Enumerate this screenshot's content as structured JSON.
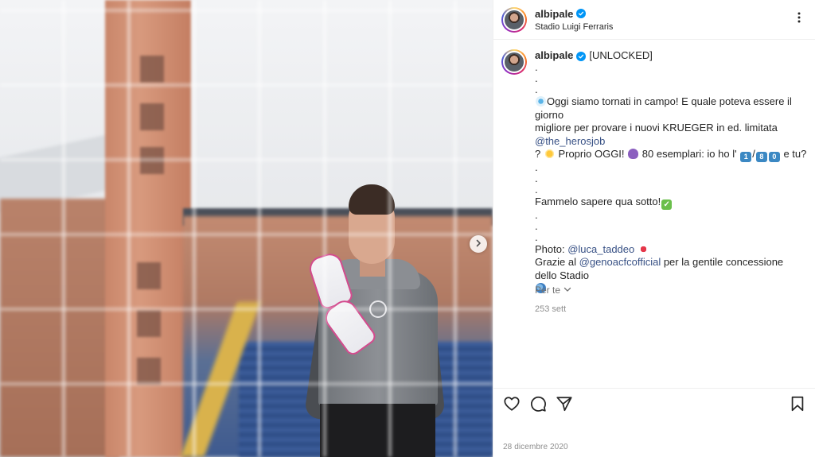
{
  "post": {
    "username": "albipale",
    "location": "Stadio Luigi Ferraris",
    "caption": {
      "tag": "[UNLOCKED]",
      "line1": "Oggi siamo tornati in campo! E quale poteva essere il giorno",
      "line2_pre": "migliore per provare i nuovi KRUEGER in ed. limitata ",
      "mention1": "@the_herosjob",
      "line3_pre": "? ",
      "line3_mid": " Proprio OGGI! ",
      "line3_post": " 80 esemplari: io ho l' ",
      "line3_slash": "/",
      "line3_end": " e tu?",
      "num1": "1",
      "num2": "8",
      "num3": "0",
      "line4": "Fammelo sapere qua sotto!",
      "photo_pre": "Photo: ",
      "mention2": "@luca_taddeo",
      "line6_pre": "Grazie al ",
      "mention3": "@genoacfcofficial",
      "line6_post": " per la gentile concessione dello Stadio",
      "dot": "."
    },
    "relative_time": "253 sett",
    "for_you_label": "Per te",
    "date": "28 dicembre 2020"
  },
  "icons": {
    "more": "more-options-icon",
    "like": "heart-icon",
    "comment": "comment-icon",
    "share": "send-icon",
    "save": "bookmark-icon",
    "next": "chevron-right-icon",
    "verified": "verified-badge-icon"
  },
  "colors": {
    "verified": "#0095f6",
    "mention": "#385185",
    "secondary_text": "#8e8e8e"
  }
}
